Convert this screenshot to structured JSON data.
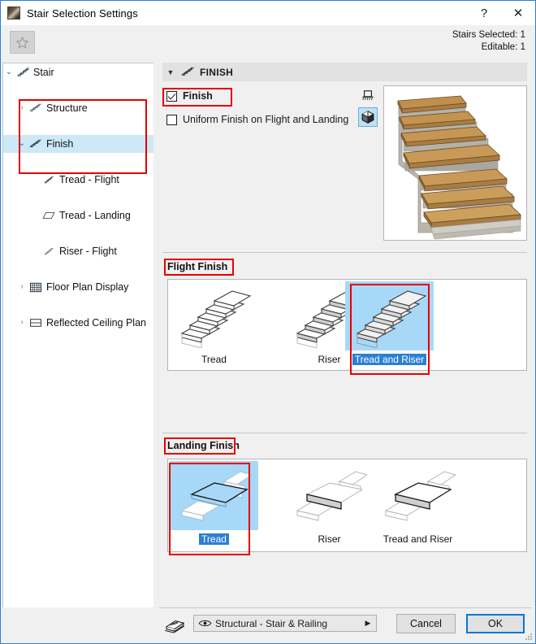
{
  "window": {
    "title": "Stair Selection Settings",
    "icon": "stair-app-icon",
    "help_label": "?",
    "close_label": "✕"
  },
  "toolbar": {
    "favorites_icon": "star-icon",
    "stairs_selected": "Stairs Selected: 1",
    "editable": "Editable: 1"
  },
  "tree": {
    "items": [
      {
        "label": "Stair",
        "icon": "stair-icon",
        "twist": "⌄",
        "expanded": true,
        "depth": 0,
        "selected": false
      },
      {
        "label": "Structure",
        "icon": "structure-icon",
        "twist": "›",
        "expanded": false,
        "depth": 1,
        "selected": false
      },
      {
        "label": "Finish",
        "icon": "finish-icon",
        "twist": "⌄",
        "expanded": true,
        "depth": 1,
        "selected": true
      },
      {
        "label": "Tread - Flight",
        "icon": "tread-flight-icon",
        "twist": "",
        "expanded": false,
        "depth": 2,
        "selected": false
      },
      {
        "label": "Tread - Landing",
        "icon": "tread-landing-icon",
        "twist": "",
        "expanded": false,
        "depth": 2,
        "selected": false
      },
      {
        "label": "Riser - Flight",
        "icon": "riser-flight-icon",
        "twist": "",
        "expanded": false,
        "depth": 2,
        "selected": false
      },
      {
        "label": "Floor Plan Display",
        "icon": "floor-plan-icon",
        "twist": "›",
        "expanded": false,
        "depth": 1,
        "selected": false
      },
      {
        "label": "Reflected Ceiling Plan",
        "icon": "ceiling-plan-icon",
        "twist": "›",
        "expanded": false,
        "depth": 1,
        "selected": false
      }
    ],
    "scroll_left": "‹",
    "scroll_right": "›"
  },
  "panel": {
    "header_title": "FINISH",
    "header_icon": "finish-icon",
    "header_caret": "▼",
    "finish_checkbox": {
      "label": "Finish",
      "checked": true
    },
    "uniform_checkbox": {
      "label": "Uniform Finish on Flight and Landing",
      "checked": false
    },
    "view_2d_icon": "2d-view-icon",
    "view_3d_icon": "3d-view-icon",
    "preview_alt": "stair-3d-preview"
  },
  "flight_finish": {
    "title": "Flight Finish",
    "options": [
      {
        "label": "Tread",
        "icon": "stair-tread-icon",
        "selected": false
      },
      {
        "label": "Riser",
        "icon": "stair-riser-icon",
        "selected": false
      },
      {
        "label": "Tread and Riser",
        "icon": "stair-tread-riser-icon",
        "selected": true
      }
    ]
  },
  "landing_finish": {
    "title": "Landing Finish",
    "options": [
      {
        "label": "Tread",
        "icon": "landing-tread-icon",
        "selected": true
      },
      {
        "label": "Riser",
        "icon": "landing-riser-icon",
        "selected": false
      },
      {
        "label": "Tread and Riser",
        "icon": "landing-tread-riser-icon",
        "selected": false
      }
    ]
  },
  "footer": {
    "pen_icon": "pen-set-icon",
    "layer_icon": "eye-icon",
    "layer_value": "Structural - Stair & Railing",
    "layer_arrow": "▶",
    "cancel_label": "Cancel",
    "ok_label": "OK"
  },
  "colors": {
    "accent": "#2b7fd4",
    "selection_bg": "#cde8f7",
    "thumb_selected_bg": "#a8d8f8",
    "annotation_red": "#e60000",
    "panel_bg": "#f0f0f0",
    "header_bg": "#e2e2e2"
  }
}
